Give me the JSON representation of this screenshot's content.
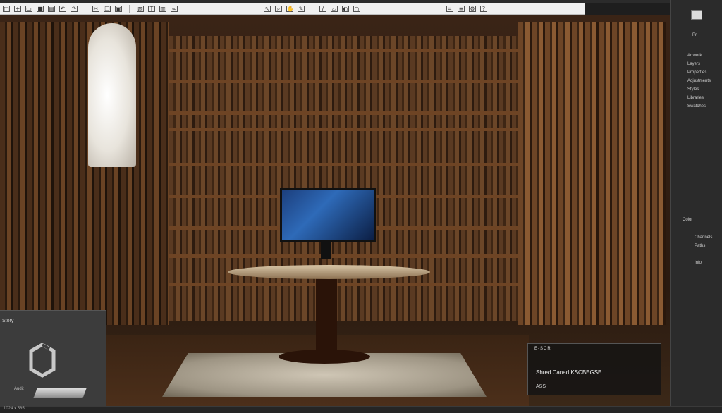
{
  "app": {
    "toolbar_icons_left": [
      "file-icon",
      "new-icon",
      "open-icon",
      "save-icon",
      "print-icon",
      "undo-icon",
      "redo-icon",
      "cut-icon",
      "copy-icon",
      "paste-icon",
      "image-icon",
      "text-icon",
      "chart-icon",
      "link-icon",
      "grid-icon",
      "table-icon"
    ],
    "toolbar_icons_right": [
      "pointer-icon",
      "zoom-icon",
      "hand-icon",
      "pen-icon",
      "brush-icon",
      "eraser-icon",
      "fill-icon",
      "shape-icon",
      "crop-icon",
      "layers-icon",
      "settings-icon",
      "help-icon"
    ]
  },
  "left_panel": {
    "label": "Story",
    "caption": "Audit"
  },
  "right_panel": {
    "items": [
      "Pr.",
      "Artwork",
      "Layers",
      "Properties",
      "Adjustments",
      "Styles",
      "Libraries",
      "Swatches",
      "Color",
      "Channels",
      "Paths",
      "Info"
    ]
  },
  "overlay": {
    "title": "E-SCR",
    "line": "Shred Canad KSCBEGSE",
    "sub": "ASS"
  },
  "status": {
    "text": "1024 x 585"
  },
  "colors": {
    "toolbar_bg": "#f0f0f0",
    "panel_bg": "#2b2b2b",
    "canvas_wood": "#5a3a22"
  }
}
